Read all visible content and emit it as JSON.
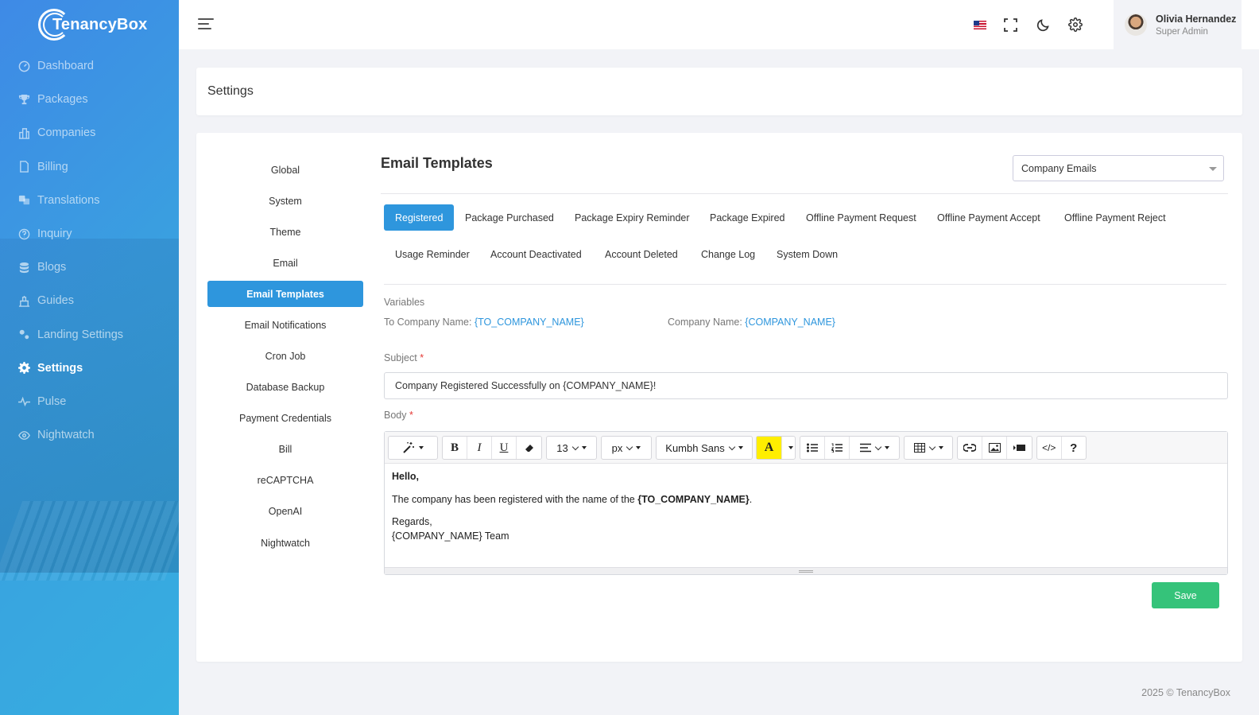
{
  "app": {
    "logo_text": "TenancyBox"
  },
  "sidebar": {
    "items": [
      {
        "label": "Dashboard",
        "icon": "dashboard-icon"
      },
      {
        "label": "Packages",
        "icon": "trophy-icon"
      },
      {
        "label": "Companies",
        "icon": "building-icon"
      },
      {
        "label": "Billing",
        "icon": "file-icon"
      },
      {
        "label": "Translations",
        "icon": "translate-icon"
      },
      {
        "label": "Inquiry",
        "icon": "question-icon"
      },
      {
        "label": "Blogs",
        "icon": "database-icon"
      },
      {
        "label": "Guides",
        "icon": "guide-icon"
      },
      {
        "label": "Landing Settings",
        "icon": "cogs-icon"
      },
      {
        "label": "Settings",
        "icon": "gear-icon",
        "active": true
      },
      {
        "label": "Pulse",
        "icon": "pulse-icon"
      },
      {
        "label": "Nightwatch",
        "icon": "eye-icon"
      }
    ]
  },
  "user": {
    "name": "Olivia Hernandez",
    "role": "Super Admin"
  },
  "page": {
    "title": "Settings"
  },
  "settings_menu": [
    {
      "label": "Global"
    },
    {
      "label": "System"
    },
    {
      "label": "Theme"
    },
    {
      "label": "Email"
    },
    {
      "label": "Email Templates",
      "active": true
    },
    {
      "label": "Email Notifications"
    },
    {
      "label": "Cron Job"
    },
    {
      "label": "Database Backup"
    },
    {
      "label": "Payment Credentials"
    },
    {
      "label": "Bill"
    },
    {
      "label": "reCAPTCHA"
    },
    {
      "label": "OpenAI"
    },
    {
      "label": "Nightwatch"
    }
  ],
  "content": {
    "title": "Email Templates",
    "select_value": "Company Emails",
    "tabs": [
      "Registered",
      "Package Purchased",
      "Package Expiry Reminder",
      "Package Expired",
      "Offline Payment Request",
      "Offline Payment Accept",
      "Offline Payment Reject",
      "Usage Reminder",
      "Account Deactivated",
      "Account Deleted",
      "Change Log",
      "System Down"
    ],
    "active_tab": "Registered",
    "variables_label": "Variables",
    "variables": [
      {
        "label": "To Company Name: ",
        "value": "{TO_COMPANY_NAME}"
      },
      {
        "label": "Company Name: ",
        "value": "{COMPANY_NAME}"
      }
    ],
    "subject_label": "Subject",
    "subject_value": "Company Registered Successfully on {COMPANY_NAME}!",
    "body_label": "Body",
    "required_mark": "*",
    "editor": {
      "font_size": "13",
      "font_unit": "px",
      "font_family": "Kumbh Sans",
      "body": {
        "greeting": "Hello,",
        "line_prefix": "The company has been registered with the name of the ",
        "line_var": "{TO_COMPANY_NAME}",
        "line_suffix": ".",
        "regards": "Regards,",
        "signature": "{COMPANY_NAME} Team"
      }
    },
    "save_label": "Save"
  },
  "footer": {
    "text": "2025 © TenancyBox"
  },
  "colors": {
    "primary": "#2e96dd",
    "success": "#35c37a",
    "required": "#e53935"
  }
}
